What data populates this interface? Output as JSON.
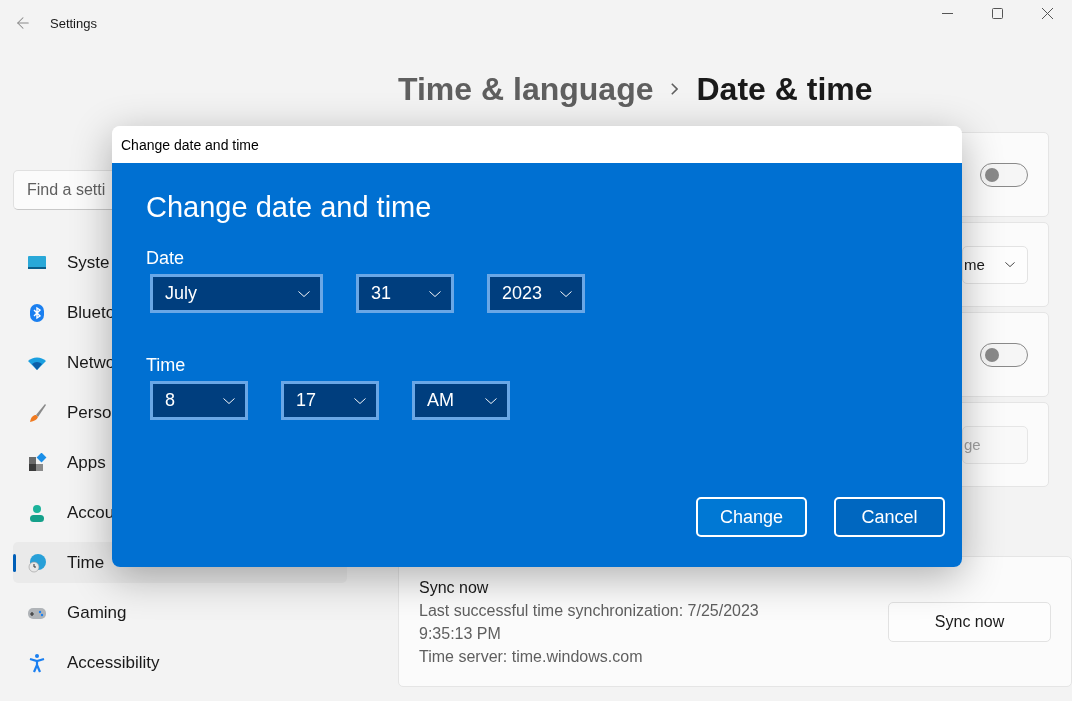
{
  "window": {
    "title": "Settings"
  },
  "search": {
    "placeholder": "Find a setti"
  },
  "sidebar": {
    "items": [
      {
        "label": "Syste",
        "selected": false
      },
      {
        "label": "Blueto",
        "selected": false
      },
      {
        "label": "Netwo",
        "selected": false
      },
      {
        "label": "Perso",
        "selected": false
      },
      {
        "label": "Apps",
        "selected": false
      },
      {
        "label": "Accou",
        "selected": false
      },
      {
        "label": "Time",
        "selected": true
      },
      {
        "label": "Gaming",
        "selected": false
      },
      {
        "label": "Accessibility",
        "selected": false
      }
    ]
  },
  "breadcrumb": {
    "parent": "Time & language",
    "current": "Date & time"
  },
  "cards": [
    {
      "kind": "toggle",
      "on": false
    },
    {
      "kind": "dropdown",
      "value": "me"
    },
    {
      "kind": "toggle",
      "on": false
    },
    {
      "kind": "button",
      "label": "ge",
      "disabled": true
    }
  ],
  "sync": {
    "title": "Sync now",
    "lines": [
      "Last successful time synchronization: 7/25/2023",
      "9:35:13 PM",
      "Time server: time.windows.com"
    ],
    "button": "Sync now"
  },
  "dialog": {
    "title": "Change date and time",
    "heading": "Change date and time",
    "date_label": "Date",
    "date_fields": [
      {
        "value": "July"
      },
      {
        "value": "31"
      },
      {
        "value": "2023"
      }
    ],
    "time_label": "Time",
    "time_fields": [
      {
        "value": "8"
      },
      {
        "value": "17"
      },
      {
        "value": "AM"
      }
    ],
    "buttons": [
      {
        "label": "Change",
        "default": true
      },
      {
        "label": "Cancel",
        "default": false
      }
    ]
  }
}
